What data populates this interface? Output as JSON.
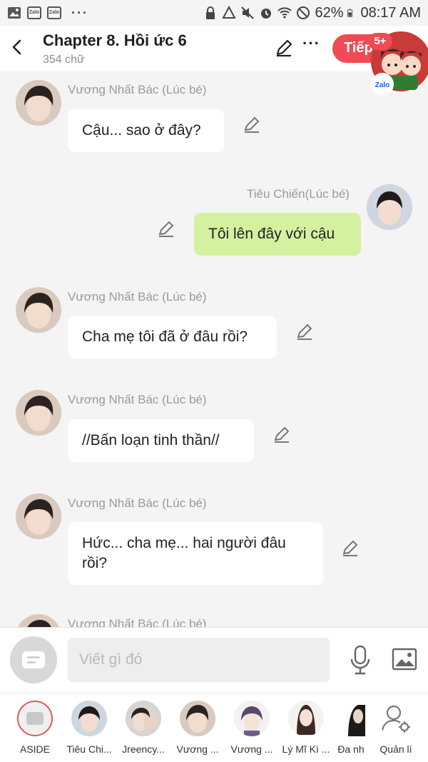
{
  "status_bar": {
    "battery": "62%",
    "time": "08:17 AM",
    "left_icons": [
      "gallery-icon",
      "zalo-icon",
      "zalo-icon",
      "more-dots-icon"
    ],
    "right_icons": [
      "lock-icon",
      "recycle-icon",
      "mute-icon",
      "alarm-icon",
      "wifi-icon",
      "dnd-icon",
      "battery-icon"
    ],
    "zalo_label": "Zalo"
  },
  "header": {
    "title": "Chapter 8. Hồi ức 6",
    "word_count": "354 chữ",
    "next_label": "Tiếp",
    "notification_count": "5+",
    "sticker_label": "Zalo"
  },
  "messages": [
    {
      "sender": "Vương Nhất Bác (Lúc bé)",
      "text": "Cậu... sao ở đây?",
      "side": "left"
    },
    {
      "sender": "Tiêu Chiến(Lúc bé)",
      "text": "Tôi lên đây với cậu",
      "side": "right"
    },
    {
      "sender": "Vương Nhất Bác (Lúc bé)",
      "text": "Cha mẹ tôi đã ở đâu rồi?",
      "side": "left"
    },
    {
      "sender": "Vương Nhất Bác (Lúc bé)",
      "text": "//Bấn loạn tinh thần//",
      "side": "left"
    },
    {
      "sender": "Vương Nhất Bác (Lúc bé)",
      "text": "Hức... cha mẹ... hai người đâu rồi?",
      "side": "left"
    },
    {
      "sender": "Vương Nhất Bác (Lúc bé)",
      "text": "",
      "side": "left"
    }
  ],
  "composer": {
    "placeholder": "Viết gì đó"
  },
  "characters": [
    {
      "label": "ASIDE"
    },
    {
      "label": "Tiêu Chi..."
    },
    {
      "label": "Jreency..."
    },
    {
      "label": "Vương ..."
    },
    {
      "label": "Vương ..."
    },
    {
      "label": "Lý Mĩ Kì ..."
    },
    {
      "label": "Đa nh"
    },
    {
      "label": "Quản lí"
    }
  ],
  "colors": {
    "accent_red": "#f04a54",
    "my_bubble": "#d4f1a0",
    "chat_bg": "#f4f4f4"
  }
}
